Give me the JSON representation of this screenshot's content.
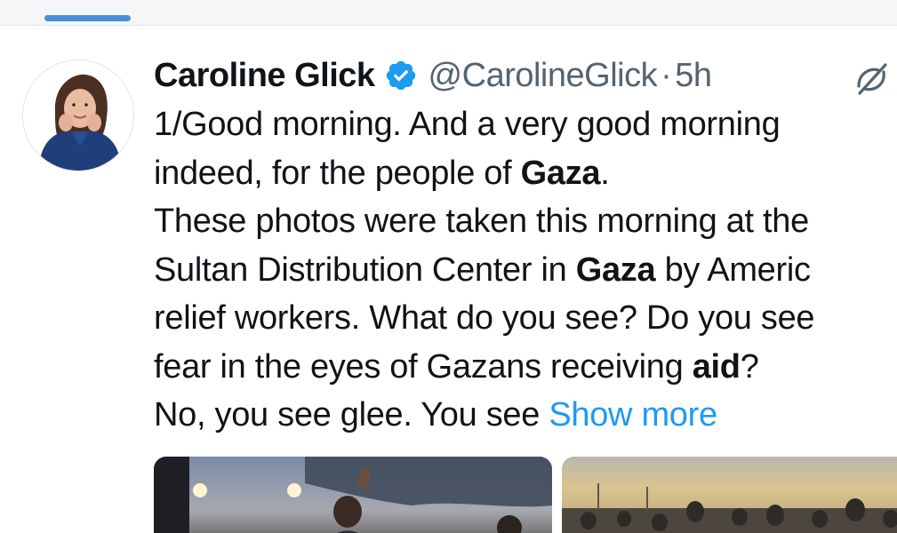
{
  "author": {
    "display_name": "Caroline Glick",
    "handle": "@CarolineGlick",
    "separator": "·",
    "time": "5h"
  },
  "tweet": {
    "line1": "1/Good morning. And a very good morning",
    "line2_prefix": "indeed, for the people of ",
    "line2_bold": "Gaza",
    "line2_suffix": ".",
    "line3": "These photos were taken this morning at the",
    "line4_prefix": "Sultan Distribution Center in ",
    "line4_bold": "Gaza",
    "line4_suffix": " by Americ",
    "line5": "relief workers. What do you see? Do you see",
    "line6_prefix": "fear in the eyes of Gazans receiving ",
    "line6_bold": "aid",
    "line6_suffix": "?",
    "line7_prefix": "No, you see glee. You see ",
    "show_more": "Show more"
  },
  "colors": {
    "link": "#1d9bf0",
    "secondary_text": "#536471",
    "verified_badge": "#1d9bf0",
    "tab_indicator": "#4a90d9"
  },
  "icons": {
    "verified": "verified-badge-icon",
    "grok": "grok-icon"
  }
}
